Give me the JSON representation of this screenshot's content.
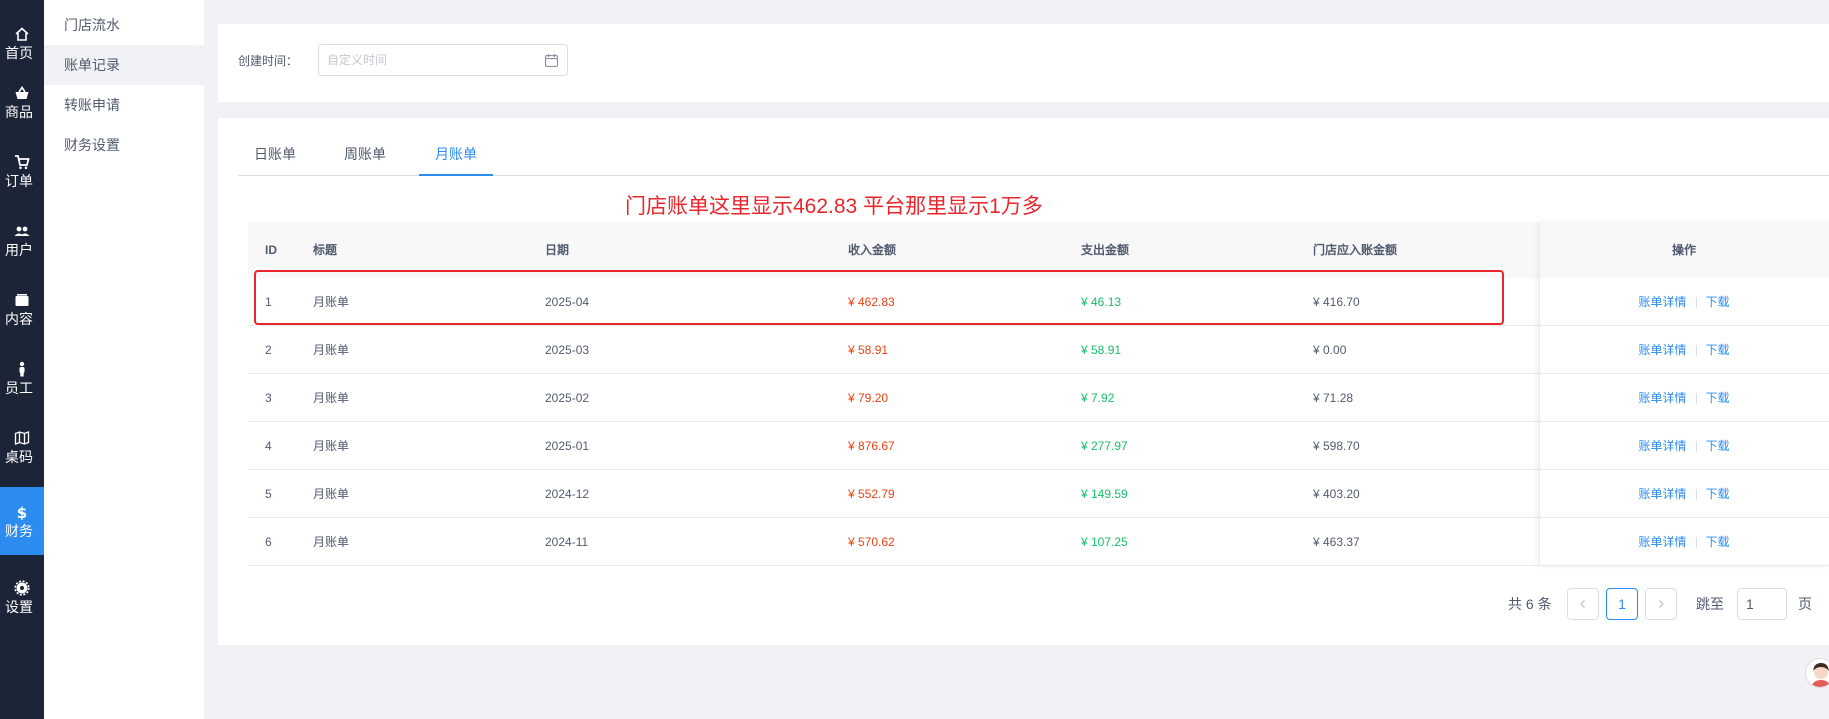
{
  "nav": [
    {
      "label": "首页",
      "icon": "home-icon"
    },
    {
      "label": "商品",
      "icon": "basket-icon"
    },
    {
      "label": "订单",
      "icon": "cart-icon"
    },
    {
      "label": "用户",
      "icon": "users-icon"
    },
    {
      "label": "内容",
      "icon": "folder-icon"
    },
    {
      "label": "员工",
      "icon": "person-icon"
    },
    {
      "label": "桌码",
      "icon": "map-icon"
    },
    {
      "label": "财务",
      "icon": "dollar-icon"
    },
    {
      "label": "设置",
      "icon": "gear-icon"
    }
  ],
  "nav_active": "财务",
  "submenu": [
    {
      "label": "门店流水"
    },
    {
      "label": "账单记录"
    },
    {
      "label": "转账申请"
    },
    {
      "label": "财务设置"
    }
  ],
  "submenu_active": "账单记录",
  "filter": {
    "label": "创建时间：",
    "placeholder": "自定义时间"
  },
  "tabs": [
    {
      "label": "日账单"
    },
    {
      "label": "周账单"
    },
    {
      "label": "月账单"
    }
  ],
  "active_tab": "月账单",
  "annotation": "门店账单这里显示462.83    平台那里显示1万多",
  "table": {
    "headers": {
      "id": "ID",
      "title": "标题",
      "date": "日期",
      "income": "收入金额",
      "expense": "支出金额",
      "store": "门店应入账金额",
      "ops": "操作"
    },
    "rows": [
      {
        "id": "1",
        "title": "月账单",
        "date": "2025-04",
        "income": "¥ 462.83",
        "expense": "¥ 46.13",
        "store": "¥ 416.70"
      },
      {
        "id": "2",
        "title": "月账单",
        "date": "2025-03",
        "income": "¥ 58.91",
        "expense": "¥ 58.91",
        "store": "¥ 0.00"
      },
      {
        "id": "3",
        "title": "月账单",
        "date": "2025-02",
        "income": "¥ 79.20",
        "expense": "¥ 7.92",
        "store": "¥ 71.28"
      },
      {
        "id": "4",
        "title": "月账单",
        "date": "2025-01",
        "income": "¥ 876.67",
        "expense": "¥ 277.97",
        "store": "¥ 598.70"
      },
      {
        "id": "5",
        "title": "月账单",
        "date": "2024-12",
        "income": "¥ 552.79",
        "expense": "¥ 149.59",
        "store": "¥ 403.20"
      },
      {
        "id": "6",
        "title": "月账单",
        "date": "2024-11",
        "income": "¥ 570.62",
        "expense": "¥ 107.25",
        "store": "¥ 463.37"
      }
    ],
    "op_detail": "账单详情",
    "op_download": "下载"
  },
  "pagination": {
    "total": "共 6 条",
    "current": "1",
    "jump_label": "跳至",
    "jump_value": "1",
    "page_suffix": "页"
  },
  "colors": {
    "primary": "#2d8cf0",
    "income": "#ed4014",
    "expense": "#19be6b",
    "annotation": "#e8262b",
    "nav_bg": "#1c2438"
  }
}
